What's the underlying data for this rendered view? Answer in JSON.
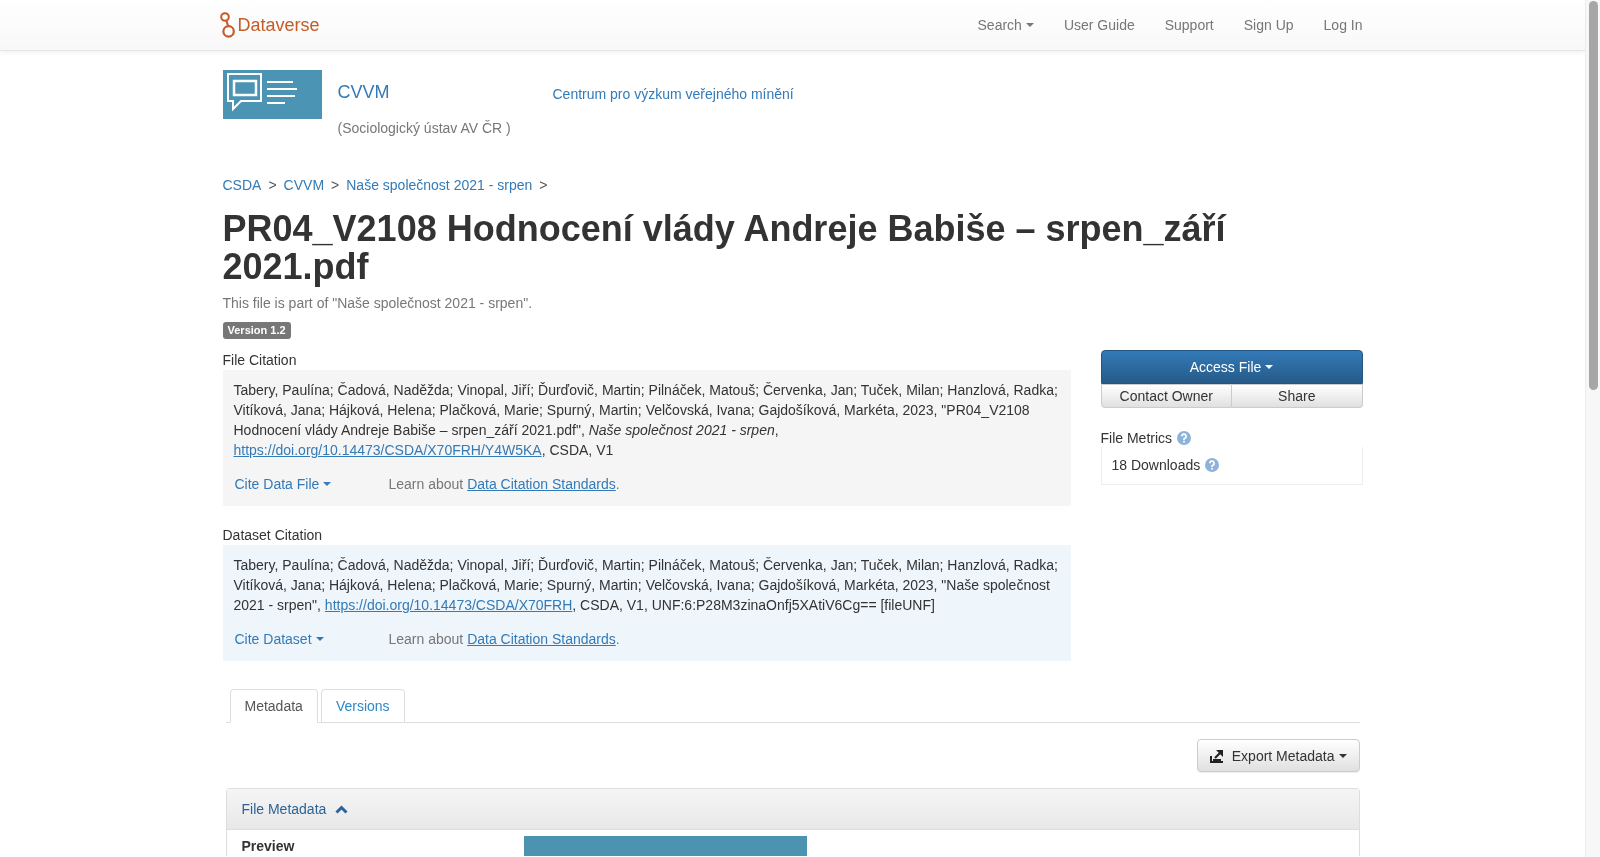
{
  "navbar": {
    "brand": "Dataverse",
    "items": [
      {
        "label": "Search",
        "kind": "dropdown"
      },
      {
        "label": "User Guide",
        "kind": "link"
      },
      {
        "label": "Support",
        "kind": "link"
      },
      {
        "label": "Sign Up",
        "kind": "link"
      },
      {
        "label": "Log In",
        "kind": "link"
      }
    ]
  },
  "collection": {
    "name": "CVVM",
    "affiliation": "(Sociologický ústav AV ČR )",
    "tagline": "Centrum pro výzkum veřejného mínění"
  },
  "breadcrumb": [
    {
      "label": "CSDA",
      "separator": ">"
    },
    {
      "label": "CVVM",
      "separator": ">"
    },
    {
      "label": "Naše společnost 2021 - srpen",
      "separator": ">"
    }
  ],
  "file": {
    "title": "PR04_V2108 Hodnocení vlády Andreje Babiše – srpen_září 2021.pdf",
    "parent_note": "This file is part of \"Naše společnost 2021 - srpen\".",
    "version": "Version 1.2"
  },
  "citations": [
    {
      "kind": "file",
      "label": "File Citation",
      "text": "Tabery, Paulína; Čadová, Naděžda; Vinopal, Jiří; Ďurďovič, Martin; Pilnáček, Matouš; Červenka, Jan; Tuček, Milan; Hanzlová, Radka; Vitíková, Jana; Hájková, Helena; Plačková, Marie; Spurný, Martin; Velčovská, Ivana; Gajdošíková, Markéta, 2023, \"PR04_V2108 Hodnocení vlády Andreje Babiše – srpen_září 2021.pdf\", *Naše společnost 2021 - srpen*,",
      "link": "https://doi.org/10.14473/CSDA/X70FRH/Y4W5KA",
      "text_after": ", CSDA, V1",
      "cite_button": "Cite Data File",
      "learn": {
        "text": "Learn about",
        "link": "Data Citation Standards",
        "end": "."
      }
    },
    {
      "kind": "dataset",
      "label": "Dataset Citation",
      "text": "Tabery, Paulína; Čadová, Naděžda; Vinopal, Jiří; Ďurďovič, Martin; Pilnáček, Matouš; Červenka, Jan; Tuček, Milan; Hanzlová, Radka; Vitíková, Jana; Hájková, Helena; Plačková, Marie; Spurný, Martin; Velčovská, Ivana; Gajdošíková, Markéta, 2023, \"Naše společnost 2021 - srpen\",",
      "link": "https://doi.org/10.14473/CSDA/X70FRH",
      "text_after": ", CSDA, V1, UNF:6:P28M3zinaOnfj5XAtiV6Cg== [fileUNF]",
      "cite_button": "Cite Dataset",
      "learn": {
        "text": "Learn about",
        "link": "Data Citation Standards",
        "end": "."
      }
    }
  ],
  "actions": {
    "access_button": "Access File",
    "buttons": [
      "Contact Owner",
      "Share"
    ]
  },
  "metrics": {
    "label": "File Metrics",
    "downloads": "18 Downloads"
  },
  "tabs": [
    {
      "label": "Metadata",
      "selected": true
    },
    {
      "label": "Versions",
      "selected": false
    }
  ],
  "export_button": "Export Metadata",
  "metadata_panel": {
    "title": "File Metadata",
    "expanded": true,
    "rows": [
      {
        "label": "Preview"
      }
    ]
  }
}
